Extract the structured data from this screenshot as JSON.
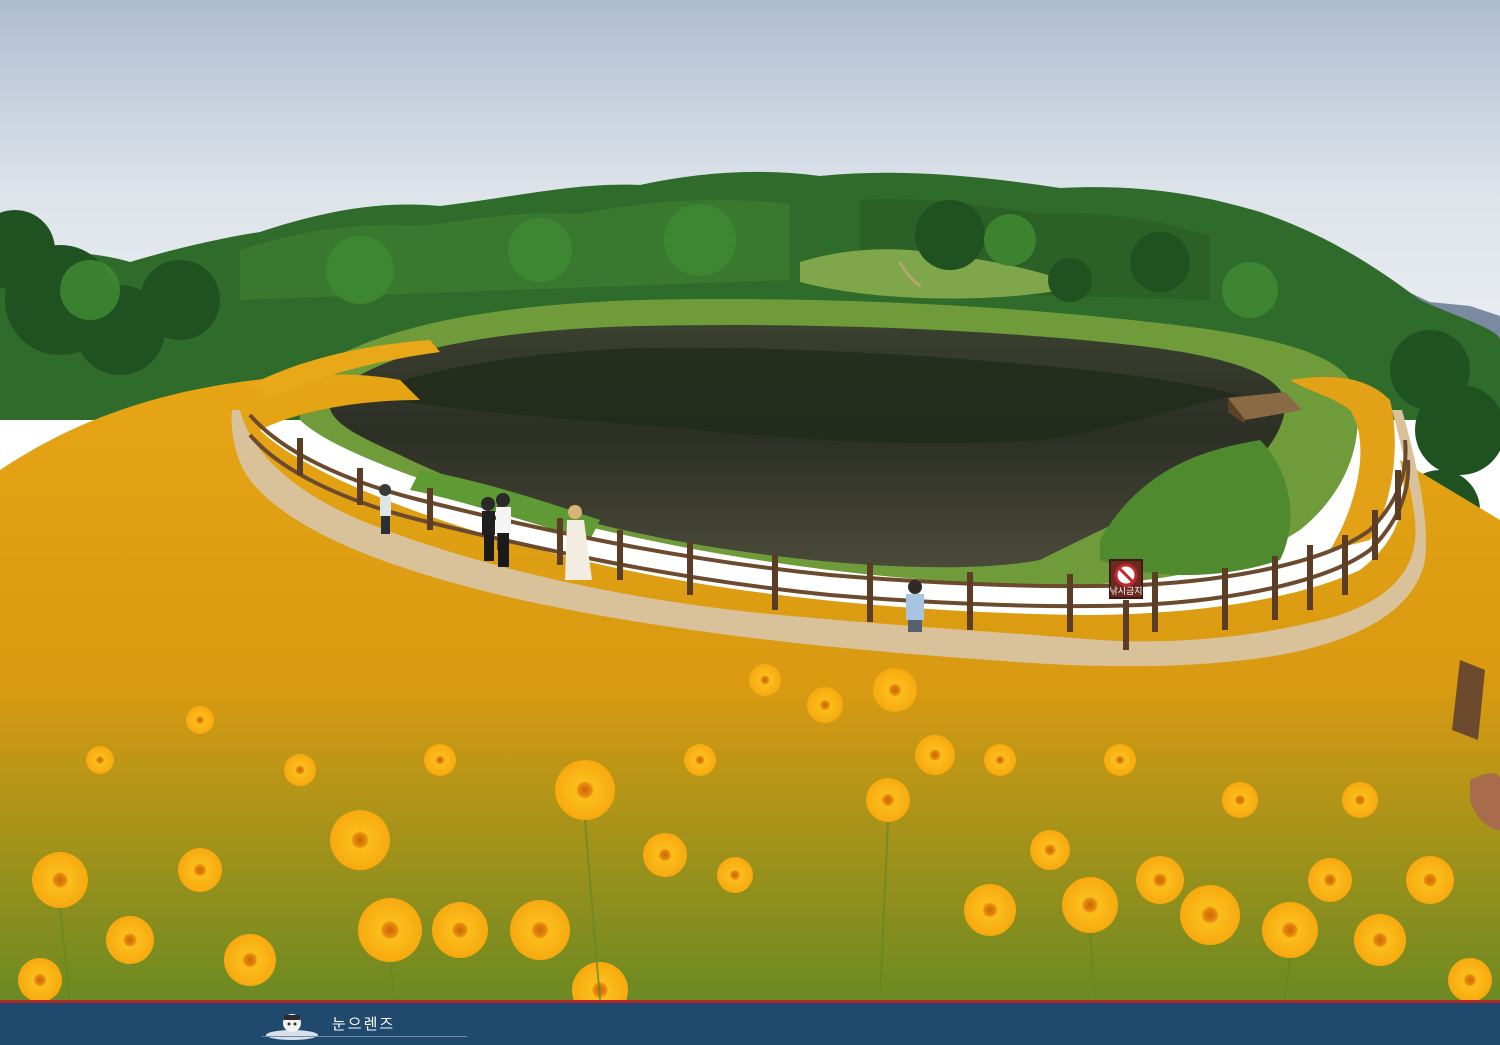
{
  "scene": {
    "type": "photograph",
    "colors": {
      "sky": "#e8ecf2",
      "forest": "#2f6b2a",
      "pond": "#2a2d22",
      "flowers": "#f6b21a",
      "path": "#d9c29a",
      "fence": "#6b4a2e"
    }
  },
  "sign": {
    "text": "낚시금지",
    "icon": "no-fishing-icon"
  },
  "footer": {
    "brand": "눈으렌즈",
    "logo_icon": "photographer-logo-icon",
    "colors": {
      "bar": "#1f4a6e",
      "line": "#b3262b"
    }
  }
}
